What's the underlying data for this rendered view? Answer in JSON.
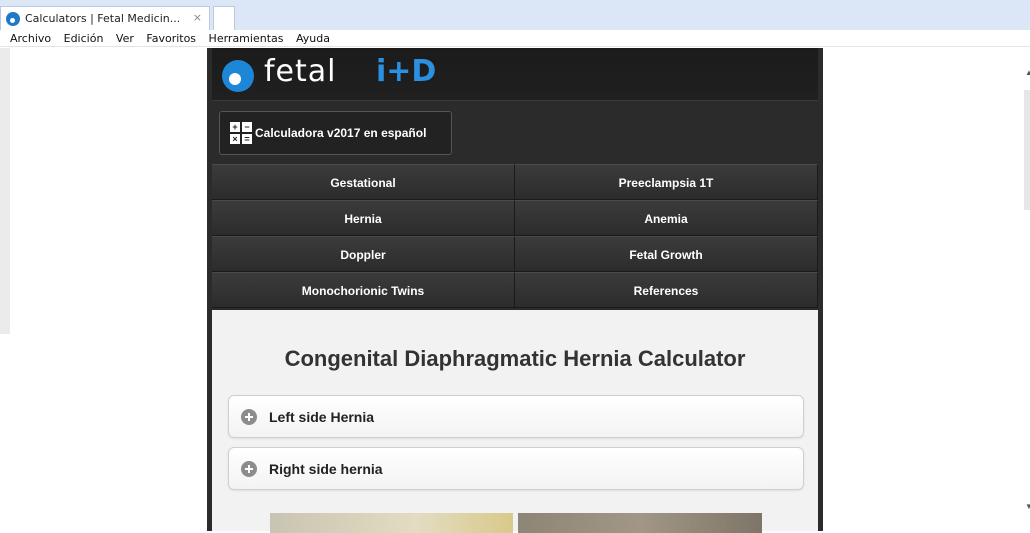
{
  "browser": {
    "tab_title": "Calculators | Fetal Medicin...",
    "tab_close": "×",
    "menu": [
      "Archivo",
      "Edición",
      "Ver",
      "Favoritos",
      "Herramientas",
      "Ayuda"
    ]
  },
  "header": {
    "logo_text": "fetal",
    "logo_accent": "i+D"
  },
  "calc_button": {
    "label": "Calculadora v2017 en español",
    "icon_symbols": [
      "+",
      "−",
      "×",
      "="
    ]
  },
  "nav": {
    "items": [
      {
        "label": "Gestational"
      },
      {
        "label": "Preeclampsia 1T"
      },
      {
        "label": "Hernia"
      },
      {
        "label": "Anemia"
      },
      {
        "label": "Doppler"
      },
      {
        "label": "Fetal Growth"
      },
      {
        "label": "Monochorionic Twins"
      },
      {
        "label": "References"
      }
    ]
  },
  "main": {
    "title": "Congenital Diaphragmatic Hernia Calculator",
    "sections": [
      {
        "label": "Left side Hernia"
      },
      {
        "label": "Right side hernia"
      }
    ]
  },
  "colors": {
    "brand_blue": "#1d86d6",
    "nav_bg": "#333333",
    "content_bg": "#f2f2f2"
  }
}
